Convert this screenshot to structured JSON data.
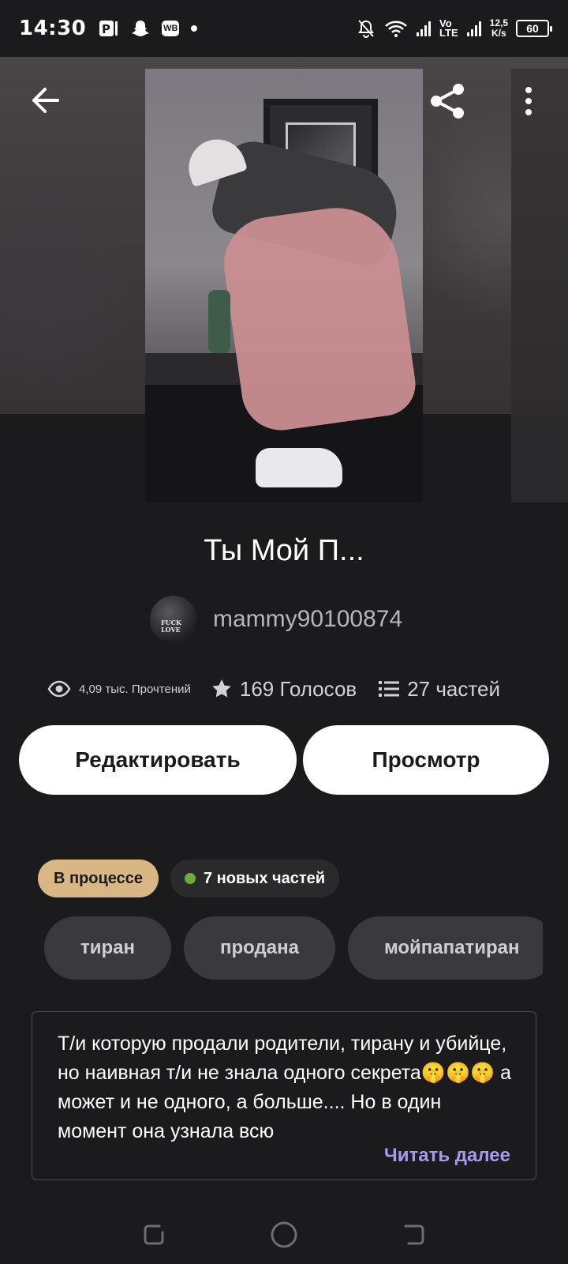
{
  "status_bar": {
    "time": "14:30",
    "left_icons": [
      "parking-icon",
      "snapchat-icon",
      "wb-icon",
      "dot-icon"
    ],
    "wb_label": "WB",
    "network_top": "Vo",
    "network_bottom": "LTE",
    "speed_value": "12,5",
    "speed_unit": "K/s",
    "battery": "60"
  },
  "story": {
    "title": "Ты Мой П...",
    "author": "mammy90100874",
    "avatar_text": "FUCK LOVE"
  },
  "stats": {
    "reads": "4,09 тыс. Прочтений",
    "votes": "169 Голосов",
    "parts": "27 частей"
  },
  "actions": {
    "edit_label": "Редактировать",
    "view_label": "Просмотр"
  },
  "status": {
    "progress_label": "В процессе",
    "new_parts_label": "7 новых частей"
  },
  "tags": [
    "тиран",
    "продана",
    "мойпапатиран"
  ],
  "description": {
    "text": "Т/и которую продали родители, тирану и убийце, но наивная т/и не знала одного секрета🤫🤫🤫 а может и не одного, а больше.... Но в один момент она узнала всю",
    "read_more": "Читать далее"
  },
  "colors": {
    "background": "#1b1a1d",
    "status_chip": "#d9b784",
    "new_dot": "#6cae3c",
    "read_more": "#a799f2"
  }
}
